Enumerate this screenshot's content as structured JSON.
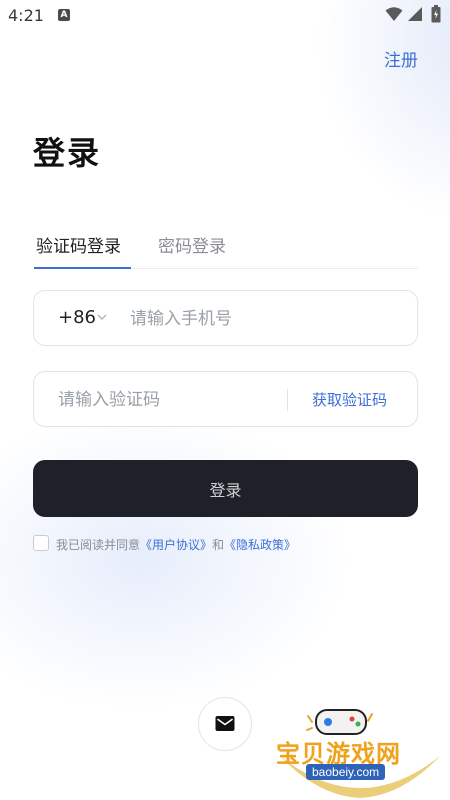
{
  "status_bar": {
    "time": "4:21",
    "app_indicator": "A",
    "icons": [
      "wifi-icon",
      "signal-icon",
      "battery-icon"
    ]
  },
  "header": {
    "register_label": "注册"
  },
  "page": {
    "title": "登录"
  },
  "tabs": [
    {
      "label": "验证码登录",
      "active": true
    },
    {
      "label": "密码登录",
      "active": false
    }
  ],
  "phone_field": {
    "country_code": "+86",
    "placeholder": "请输入手机号",
    "value": ""
  },
  "code_field": {
    "placeholder": "请输入验证码",
    "value": "",
    "get_code_label": "获取验证码"
  },
  "login_button": {
    "label": "登录"
  },
  "agreement": {
    "checked": false,
    "prefix": "我已阅读并同意",
    "user_agreement": "《用户协议》",
    "conjunction": "和",
    "privacy_policy": "《隐私政策》"
  },
  "alt_login": {
    "icon": "mail-icon"
  },
  "watermark": {
    "text": "宝贝游戏网",
    "url": "baobeiy.com"
  },
  "colors": {
    "accent": "#3d6fd8",
    "button_bg": "#1e2128",
    "title": "#111111",
    "placeholder": "#9aa0a8"
  }
}
